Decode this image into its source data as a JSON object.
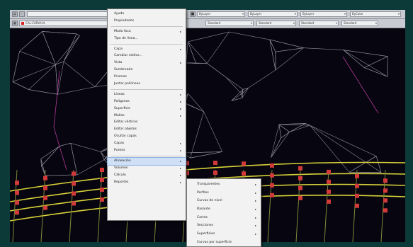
{
  "toolbar_top": {
    "field_1": "ByLayer",
    "field_2": "ByLayer",
    "field_3": "ByLayer",
    "field_4": "ByColor"
  },
  "toolbar_bottom": {
    "layer": "CAL-CURVA-N",
    "field_1": "Standard",
    "field_2": "Standard",
    "field_3": "Standard",
    "field_4": "Standard"
  },
  "context_menu": {
    "items": [
      {
        "label": "Ayuda",
        "submenu": false
      },
      {
        "label": "Propiedades",
        "submenu": false
      },
      {
        "label": "Modo foco",
        "submenu": true
      },
      {
        "label": "Tipo de línea...",
        "submenu": false
      },
      {
        "label": "Capa",
        "submenu": true
      },
      {
        "label": "Cambiar estilos...",
        "submenu": false
      },
      {
        "label": "Vista",
        "submenu": true
      },
      {
        "label": "Sombreado",
        "submenu": false
      },
      {
        "label": "Prismas",
        "submenu": false
      },
      {
        "label": "Juntar polilíneas",
        "submenu": false
      },
      {
        "label": "Líneas",
        "submenu": true
      },
      {
        "label": "Polígonos",
        "submenu": true
      },
      {
        "label": "Superficie",
        "submenu": true
      },
      {
        "label": "Mallas",
        "submenu": true
      },
      {
        "label": "Editar vértices",
        "submenu": false
      },
      {
        "label": "Editar objetos",
        "submenu": false
      },
      {
        "label": "Ocultar capas",
        "submenu": false
      },
      {
        "label": "Capas",
        "submenu": true
      },
      {
        "label": "Puntos",
        "submenu": true
      },
      {
        "label": "Alineación",
        "submenu": true,
        "highlighted": true
      },
      {
        "label": "Volumen",
        "submenu": true
      },
      {
        "label": "Cálculo",
        "submenu": true
      },
      {
        "label": "Reportes",
        "submenu": true
      }
    ],
    "separator_after": [
      1,
      3,
      9,
      18
    ]
  },
  "submenu": {
    "items": [
      {
        "label": "Transparentes",
        "submenu": true
      },
      {
        "label": "Perfiles",
        "submenu": true
      },
      {
        "label": "Curvas de nivel",
        "submenu": true
      },
      {
        "label": "Rasante",
        "submenu": true
      },
      {
        "label": "Cortes",
        "submenu": true
      },
      {
        "label": "Secciones",
        "submenu": true
      },
      {
        "label": "Superficies",
        "submenu": true
      },
      {
        "label": "Curvas por superficie",
        "submenu": false
      }
    ]
  },
  "colors": {
    "canvas": "#07050f",
    "tin_lines": "#8a8a98",
    "contour_yellow": "#d8d23a",
    "node_red": "#d23a3a",
    "highlight": "#cfe0f6"
  }
}
